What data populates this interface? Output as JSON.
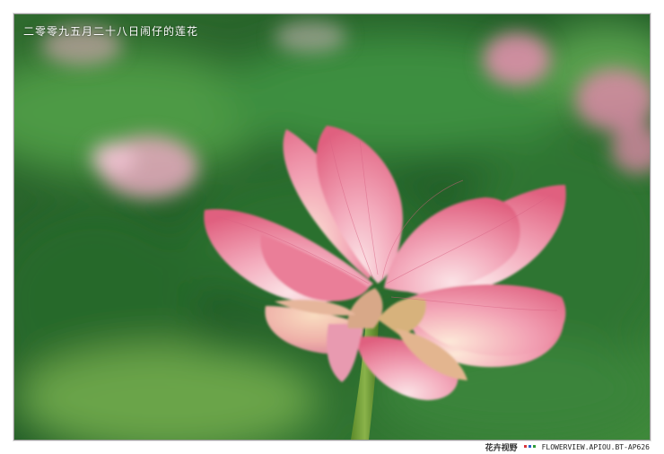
{
  "photo": {
    "caption": "二零零九五月二十八日闹仔的莲花",
    "subject": "pink-lotus-flower"
  },
  "footer": {
    "logo_text": "花卉视野",
    "credit": "FLOWERVIEW.APIOU.BT-AP626"
  },
  "colors": {
    "background": "#ffffff",
    "petal_pink": "#e8758f",
    "petal_light": "#f6b8c8",
    "foliage_green": "#2e7a35"
  }
}
